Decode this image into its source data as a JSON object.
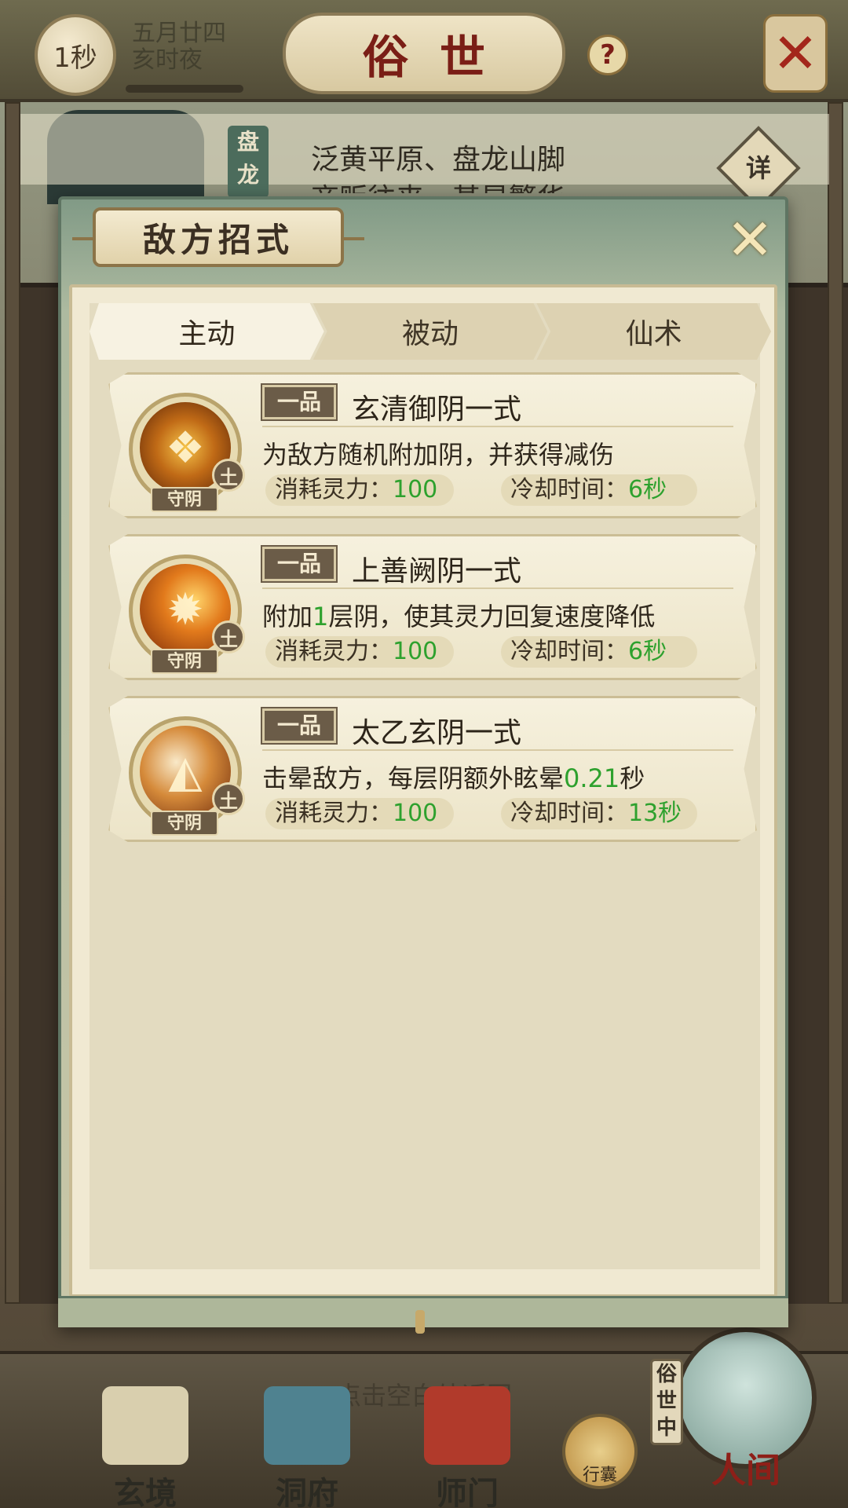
{
  "topbar": {
    "speed_label": "1秒",
    "date_line1": "五月廿四",
    "date_line2": "亥时夜",
    "title": "俗世",
    "help_label": "?",
    "menu_label": "✕"
  },
  "location": {
    "tag": "盘龙",
    "line1": "泛黄平原、盘龙山脚",
    "line2": "商贩往来，甚是繁华",
    "detail_label": "详"
  },
  "modal": {
    "title": "敌方招式",
    "close_label": "✕",
    "tabs": [
      {
        "label": "主动",
        "active": true
      },
      {
        "label": "被动",
        "active": false
      },
      {
        "label": "仙术",
        "active": false
      }
    ],
    "skills": [
      {
        "grade": "一品",
        "name": "玄清御阴一式",
        "desc_pre": "为敌方随机附加阴，并获得减伤",
        "desc_hl": "",
        "desc_post": "",
        "element": "土",
        "type": "守阴",
        "cost_label": "消耗灵力：",
        "cost_value": "100",
        "cd_label": "冷却时间：",
        "cd_value": "6秒",
        "icon": "jade-ruyi-icon"
      },
      {
        "grade": "一品",
        "name": "上善阙阴一式",
        "desc_pre": "附加",
        "desc_hl": "1",
        "desc_post": "层阴，使其灵力回复速度降低",
        "element": "土",
        "type": "守阴",
        "cost_label": "消耗灵力：",
        "cost_value": "100",
        "cd_label": "冷却时间：",
        "cd_value": "6秒",
        "icon": "flame-gourd-icon"
      },
      {
        "grade": "一品",
        "name": "太乙玄阴一式",
        "desc_pre": "击晕敌方，每层阴额外眩晕",
        "desc_hl": "0.21",
        "desc_post": "秒",
        "element": "土",
        "type": "守阴",
        "cost_label": "消耗灵力：",
        "cost_value": "100",
        "cd_label": "冷却时间：",
        "cd_value": "13秒",
        "icon": "folding-fan-icon"
      }
    ]
  },
  "bottom": {
    "hint": "点击空白处返回",
    "nav": [
      {
        "label": "玄境"
      },
      {
        "label": "洞府"
      },
      {
        "label": "师门"
      }
    ],
    "bag_label": "行囊",
    "world_side": "俗世中",
    "world_label": "人间"
  },
  "colors": {
    "accent_green": "#2ea12e",
    "title_red": "#7a1e16",
    "modal_green": "#819a86"
  }
}
